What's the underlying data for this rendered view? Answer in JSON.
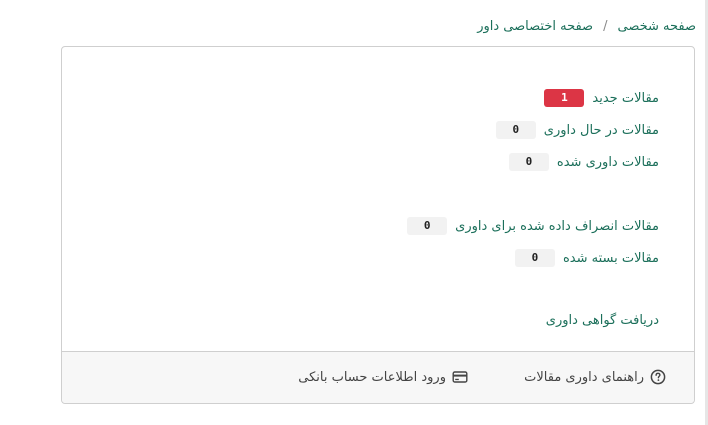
{
  "breadcrumb": {
    "items": [
      "صفحه شخصی",
      "صفحه اختصاصی داور"
    ],
    "separator": "/"
  },
  "stats": {
    "new_articles": {
      "label": "مقالات جدید",
      "count": "1"
    },
    "in_review": {
      "label": "مقالات در حال داوری",
      "count": "0"
    },
    "reviewed": {
      "label": "مقالات داوری شده",
      "count": "0"
    },
    "declined": {
      "label": "مقالات انصراف داده شده برای داوری",
      "count": "0"
    },
    "closed": {
      "label": "مقالات بسته شده",
      "count": "0"
    }
  },
  "certificate_link": "دریافت گواهی داوری",
  "footer": {
    "guide_label": "راهنمای داوری مقالات",
    "guide_icon": "question-circle-icon",
    "bank_label": "ورود اطلاعات حساب بانکی",
    "bank_icon": "credit-card-icon"
  },
  "colors": {
    "link": "#1b6f5a",
    "badge_new": "#dc3545"
  }
}
